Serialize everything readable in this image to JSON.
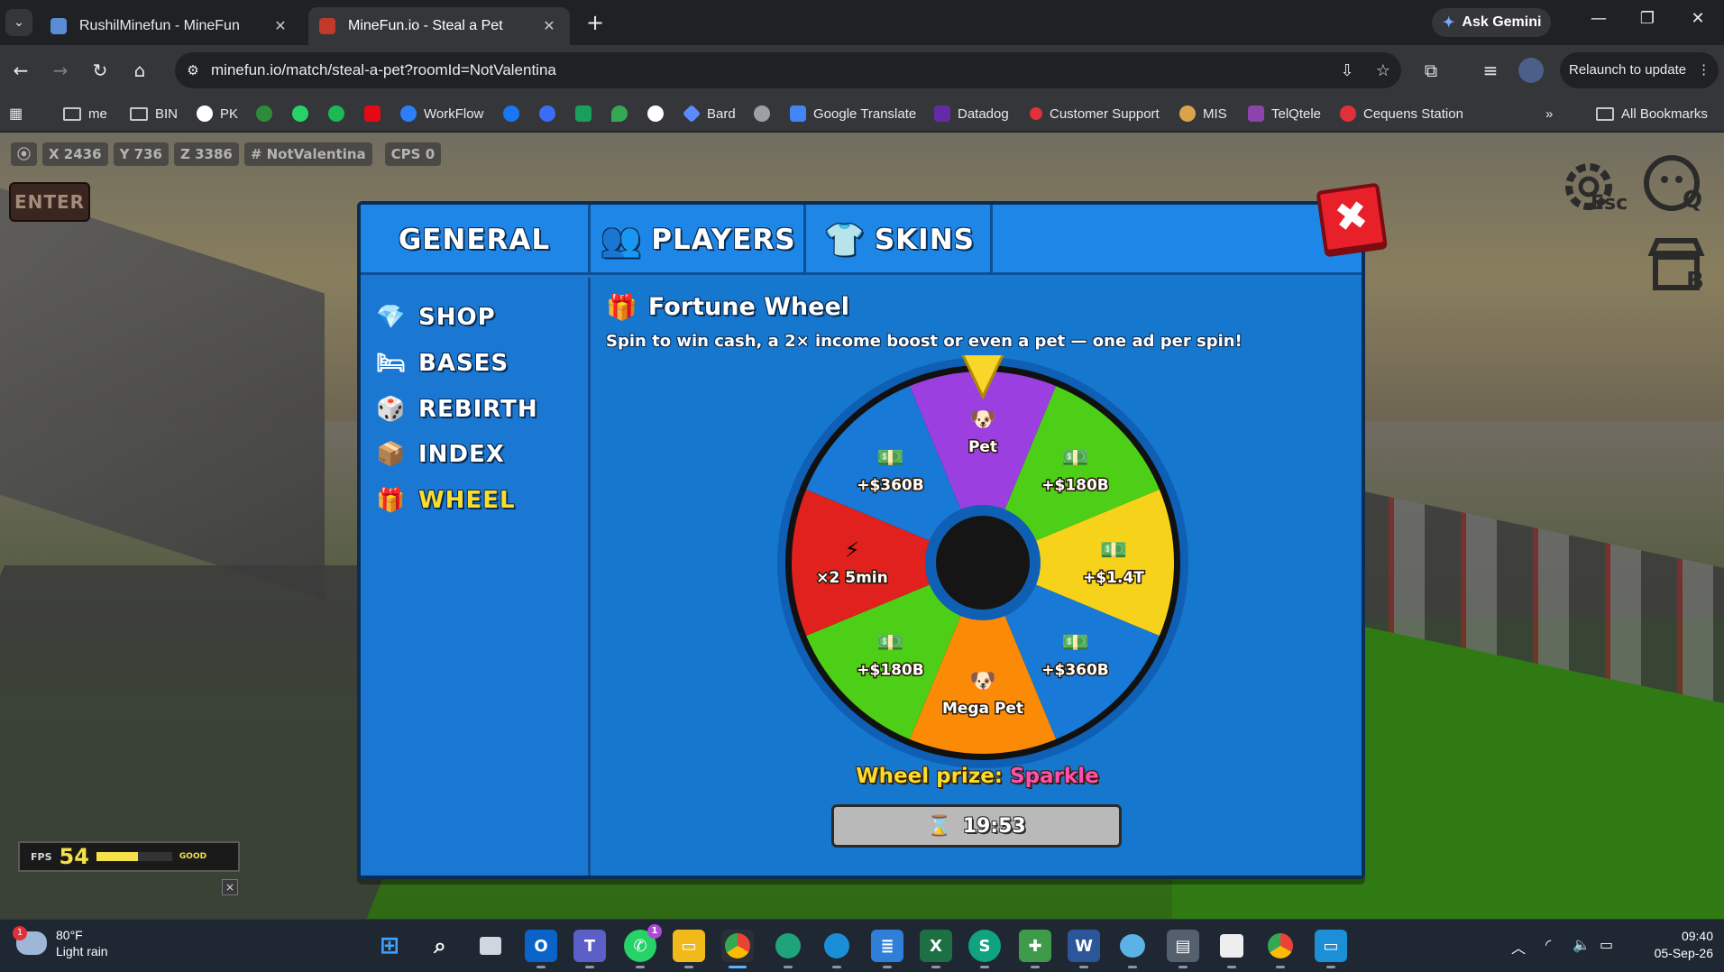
{
  "browser": {
    "tabs": [
      {
        "title": "RushilMinefun - MineFun",
        "active": false
      },
      {
        "title": "MineFun.io - Steal a Pet",
        "active": true
      }
    ],
    "ask_gemini": "Ask Gemini",
    "url": "minefun.io/match/steal-a-pet?roomId=NotValentina",
    "relaunch": "Relaunch to update",
    "bookmarks": [
      "me",
      "BIN",
      "PK",
      "WorkFlow",
      "Bard",
      "Google Translate",
      "Datadog",
      "Customer Support",
      "MIS",
      "TelQtele",
      "Cequens Station"
    ],
    "all_bookmarks": "All Bookmarks"
  },
  "hud": {
    "x": "X 2436",
    "y": "Y 736",
    "z": "Z 3386",
    "room": "# NotValentina",
    "cps": "CPS 0",
    "enter": "ENTER",
    "esc_key": "Esc",
    "q_key": "Q",
    "b_key": "B",
    "fps_label": "FPS",
    "fps_value": "54",
    "fps_fill": 0.55,
    "fps_status": "GOOD",
    "fps_close": "×"
  },
  "modal": {
    "tabs": [
      "GENERAL",
      "PLAYERS",
      "SKINS"
    ],
    "close": "✖",
    "sidebar": [
      {
        "label": "SHOP",
        "icon": "diamond-icon",
        "active": false
      },
      {
        "label": "BASES",
        "icon": "bed-icon",
        "active": false
      },
      {
        "label": "REBIRTH",
        "icon": "dice-icon",
        "active": false
      },
      {
        "label": "INDEX",
        "icon": "crate-icon",
        "active": false
      },
      {
        "label": "WHEEL",
        "icon": "gift-icon",
        "active": true
      }
    ],
    "wheel": {
      "title": "Fortune Wheel",
      "subtitle": "Spin to win cash, a 2× income boost or even a pet — one ad per spin!",
      "segments": [
        {
          "label": "Pet",
          "color": "#9b3fe0",
          "icon": "pet-icon"
        },
        {
          "label": "+$180B",
          "color": "#4ccf16",
          "icon": "cash-icon"
        },
        {
          "label": "+$1.4T",
          "color": "#f6d31a",
          "icon": "cash-icon"
        },
        {
          "label": "+$360B",
          "color": "#1879d6",
          "icon": "cash-icon"
        },
        {
          "label": "Mega Pet",
          "color": "#fb8b07",
          "icon": "pet-icon"
        },
        {
          "label": "+$180B",
          "color": "#4ccf16",
          "icon": "cash-icon"
        },
        {
          "label": "×2 5min",
          "color": "#e0211d",
          "icon": "bolt-icon"
        },
        {
          "label": "+$360B",
          "color": "#1879d6",
          "icon": "cash-icon"
        }
      ],
      "prize_label": "Wheel prize:",
      "prize_value": "Sparkle",
      "timer": "19:53"
    }
  },
  "taskbar": {
    "temp": "80°F",
    "weather": "Light rain",
    "weather_badge": "1",
    "whatsapp_badge": "1",
    "time": "09:40",
    "date": "05-Sep-26"
  }
}
